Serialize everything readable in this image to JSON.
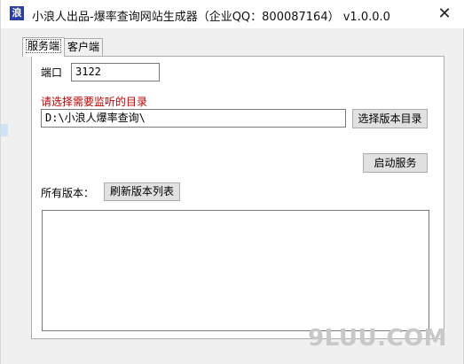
{
  "window": {
    "title": "小浪人出品-爆率查询网站生成器（企业QQ：800087164） v1.0.0.0",
    "icon_glyph": "浪",
    "close_glyph": "✕"
  },
  "tabs": [
    {
      "label": "服务端",
      "active": true
    },
    {
      "label": "客户端",
      "active": false
    }
  ],
  "server": {
    "port_label": "端口",
    "port_value": "3122",
    "dir_prompt": "请选择需要监听的目录",
    "dir_value": "D:\\小浪人爆率查询\\",
    "choose_dir_button": "选择版本目录",
    "start_button": "启动服务",
    "versions_label": "所有版本：",
    "refresh_button": "刷新版本列表",
    "versions": []
  },
  "watermark": "9LUU.COM",
  "colors": {
    "prompt_red": "#c00000",
    "icon_blue": "#2b3ea8"
  }
}
